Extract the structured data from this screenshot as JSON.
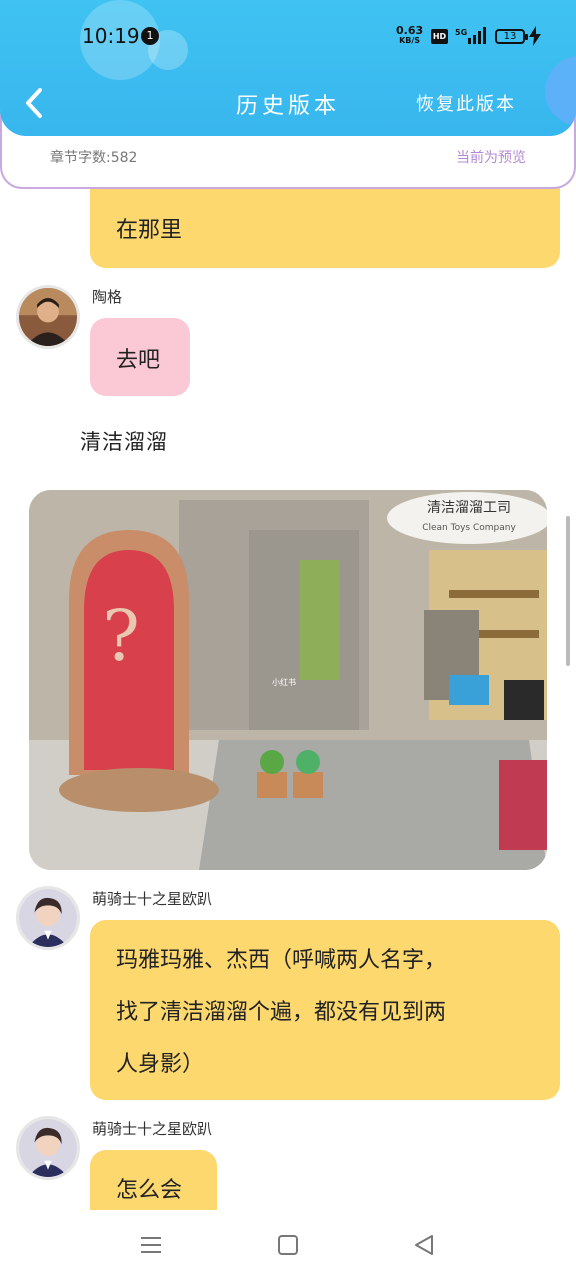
{
  "status_bar": {
    "time": "10:19",
    "notification_count": "1",
    "net_speed": "0.63",
    "net_unit": "KB/S",
    "hd_label": "HD",
    "network_label": "5G",
    "battery_level": "13"
  },
  "header": {
    "title": "历史版本",
    "restore_label": "恢复此版本",
    "accent_color": "#3fc3f2"
  },
  "info_bar": {
    "word_count": "章节字数:582",
    "preview_label": "当前为预览"
  },
  "messages": [
    {
      "text": "在那里"
    },
    {
      "speaker": "陶格",
      "text": "去吧"
    },
    {
      "narration": "清洁溜溜"
    },
    {
      "image_label": "小红书",
      "sign_line1": "清洁溜溜工司",
      "sign_line2": "Clean Toys Company"
    },
    {
      "speaker": "萌骑士十之星欧趴",
      "lines": [
        "玛雅玛雅、杰西（呼喊两人名字，",
        "找了清洁溜溜个遍，都没有见到两",
        "人身影）"
      ]
    },
    {
      "speaker": "萌骑士十之星欧趴",
      "text": "怎么会"
    }
  ],
  "colors": {
    "bubble_yellow": "#fdd86f",
    "bubble_pink": "#fbc9d6",
    "preview_purple": "#b48ad4"
  }
}
